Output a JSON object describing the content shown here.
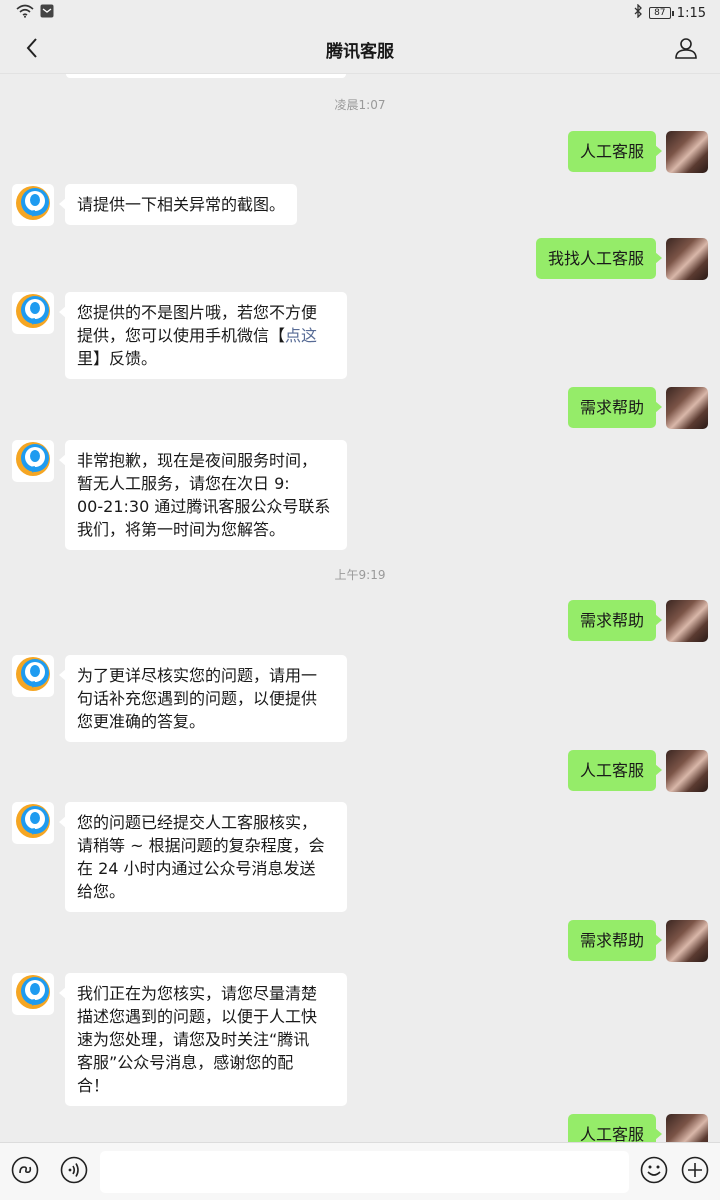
{
  "status": {
    "time": "1:15",
    "battery": "87"
  },
  "nav": {
    "title": "腾讯客服"
  },
  "chat": {
    "timestamps": [
      "凌晨1:07",
      "上午9:19"
    ],
    "messages": [
      {
        "side": "right",
        "lines": [
          "人工客服"
        ]
      },
      {
        "side": "left",
        "lines": [
          "请提供一下相关异常的截图。"
        ]
      },
      {
        "side": "right",
        "lines": [
          "我找人工客服"
        ]
      },
      {
        "side": "left",
        "lines": [
          "您提供的不是图片哦，若您不方便",
          "提供，您可以使用手机微信【",
          "里】反馈。"
        ],
        "link": "点这"
      },
      {
        "side": "right",
        "lines": [
          "需求帮助"
        ]
      },
      {
        "side": "left",
        "lines": [
          "非常抱歉，现在是夜间服务时间，",
          "暂无人工服务，请您在次日 9:",
          "00-21:30 通过腾讯客服公众号联系",
          "我们，将第一时间为您解答。"
        ]
      },
      {
        "side": "right",
        "lines": [
          "需求帮助"
        ]
      },
      {
        "side": "left",
        "lines": [
          "为了更详尽核实您的问题，请用一",
          "句话补充您遇到的问题，以便提供",
          "您更准确的答复。"
        ]
      },
      {
        "side": "right",
        "lines": [
          "人工客服"
        ]
      },
      {
        "side": "left",
        "lines": [
          "您的问题已经提交人工客服核实，",
          "请稍等 ~ 根据问题的复杂程度，会",
          "在 24 小时内通过公众号消息发送",
          "给您。"
        ]
      },
      {
        "side": "right",
        "lines": [
          "需求帮助"
        ]
      },
      {
        "side": "left",
        "lines": [
          "我们正在为您核实，请您尽量清楚",
          "描述您遇到的问题，以便于人工快",
          "速为您处理，请您及时关注“腾讯",
          "客服”公众号消息，感谢您的配",
          "合！"
        ]
      },
      {
        "side": "right",
        "lines": [
          "人工客服"
        ]
      }
    ]
  },
  "input": {
    "placeholder": ""
  },
  "colors": {
    "self_bubble": "#95ec69",
    "other_bubble": "#ffffff",
    "background": "#ededed",
    "link": "#576b95"
  }
}
